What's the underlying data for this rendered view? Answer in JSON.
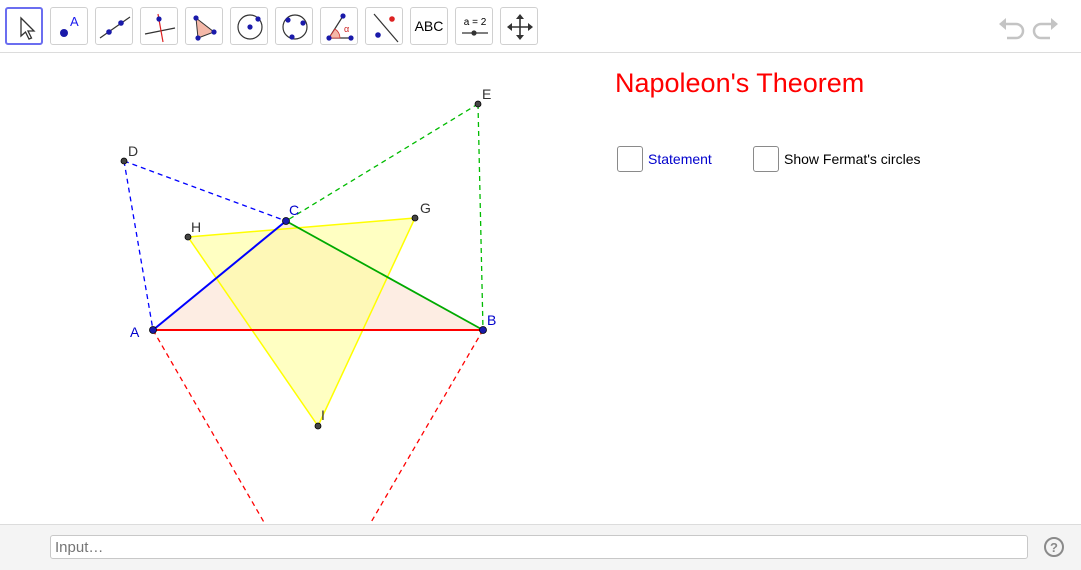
{
  "toolbar": {
    "tools": [
      {
        "name": "move-tool"
      },
      {
        "name": "point-tool",
        "label": "A"
      },
      {
        "name": "line-tool"
      },
      {
        "name": "perpendicular-line-tool"
      },
      {
        "name": "polygon-tool"
      },
      {
        "name": "circle-tool"
      },
      {
        "name": "circle-three-points-tool"
      },
      {
        "name": "angle-tool",
        "label": "α"
      },
      {
        "name": "reflect-tool"
      },
      {
        "name": "text-tool",
        "label": "ABC"
      },
      {
        "name": "slider-tool",
        "label": "a = 2"
      },
      {
        "name": "move-view-tool"
      }
    ],
    "selected": "move-tool"
  },
  "title": "Napoleon's Theorem",
  "checkboxes": {
    "statement": {
      "label": "Statement",
      "checked": false
    },
    "fermat": {
      "label": "Show Fermat's circles",
      "checked": false
    }
  },
  "points": {
    "A": {
      "label": "A",
      "color": "#0000cc"
    },
    "B": {
      "label": "B",
      "color": "#0000cc"
    },
    "C": {
      "label": "C",
      "color": "#0000cc"
    },
    "D": {
      "label": "D",
      "color": "#333333"
    },
    "E": {
      "label": "E",
      "color": "#333333"
    },
    "G": {
      "label": "G",
      "color": "#333333"
    },
    "H": {
      "label": "H",
      "color": "#333333"
    },
    "I": {
      "label": "I",
      "color": "#333333"
    }
  },
  "colors": {
    "side_ab": "#ff0000",
    "side_bc": "#00aa00",
    "side_ca": "#0000ff",
    "napoleon_triangle": "#ffff66",
    "triangle_fill": "#fde3d5"
  },
  "input_bar": {
    "placeholder": "Input…"
  },
  "help": "?"
}
